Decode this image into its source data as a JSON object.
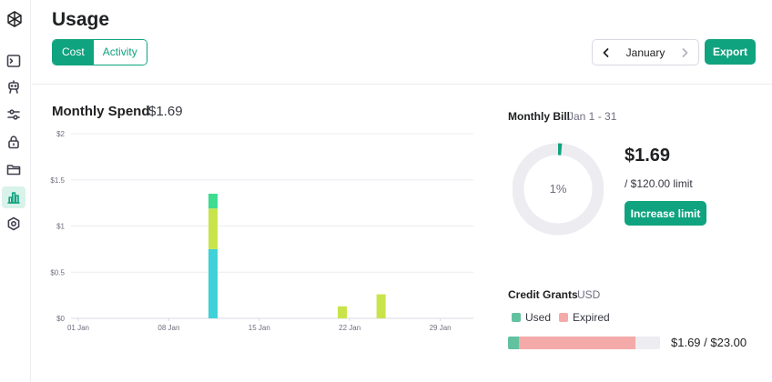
{
  "app": {
    "title": "Usage"
  },
  "sidebar": {
    "items": [
      {
        "name": "terminal-icon",
        "active": false
      },
      {
        "name": "assistant-icon",
        "active": false
      },
      {
        "name": "tune-icon",
        "active": false
      },
      {
        "name": "lock-icon",
        "active": false
      },
      {
        "name": "folder-icon",
        "active": false
      },
      {
        "name": "usage-chart-icon",
        "active": true
      },
      {
        "name": "gear-icon",
        "active": false
      }
    ]
  },
  "header": {
    "tabs": [
      {
        "label": "Cost",
        "active": true
      },
      {
        "label": "Activity",
        "active": false
      }
    ],
    "month": "January",
    "export_label": "Export"
  },
  "spend": {
    "title": "Monthly Spend",
    "amount": "$1.69"
  },
  "chart_data": {
    "type": "bar",
    "stacked": true,
    "title": "",
    "xlabel": "",
    "ylabel": "",
    "ylim": [
      0,
      2
    ],
    "y_ticks": [
      "$0",
      "$0.5",
      "$1",
      "$1.5",
      "$2"
    ],
    "x_ticks": [
      "01 Jan",
      "08 Jan",
      "15 Jan",
      "22 Jan",
      "29 Jan"
    ],
    "grid": true,
    "categories": [
      "11 Jan",
      "21 Jan",
      "24 Jan"
    ],
    "series": [
      {
        "color": "#3fd1d8",
        "values": [
          0.75,
          0,
          0
        ]
      },
      {
        "color": "#c9e44a",
        "values": [
          0.44,
          0.13,
          0.26
        ]
      },
      {
        "color": "#3ddc91",
        "values": [
          0.16,
          0,
          0
        ]
      }
    ]
  },
  "bill": {
    "title": "Monthly Bill",
    "range": "Jan 1 - 31",
    "percent_label": "1%",
    "percent_value": 0.014,
    "amount": "$1.69",
    "limit": "/ $120.00 limit",
    "increase_label": "Increase limit",
    "track_color": "#ececf1",
    "fill_color": "#10a37f"
  },
  "credits": {
    "title": "Credit Grants",
    "currency": "USD",
    "legend": [
      {
        "label": "Used",
        "color": "#62c2a0"
      },
      {
        "label": "Expired",
        "color": "#f4aaa9"
      }
    ],
    "used_fraction": 0.07,
    "expired_fraction": 0.77,
    "total": "$1.69 / $23.00"
  }
}
